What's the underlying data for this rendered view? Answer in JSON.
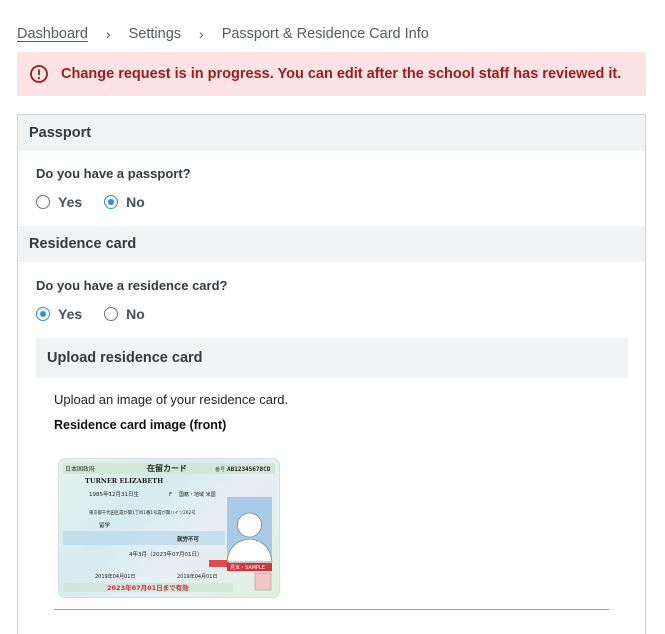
{
  "breadcrumb": {
    "items": [
      "Dashboard",
      "Settings",
      "Passport & Residence Card Info"
    ],
    "separator": "›"
  },
  "alert": {
    "message": "Change request is in progress. You can edit after the school staff has reviewed it.",
    "icon": "info-circle-icon",
    "color": "#9b1c22",
    "background": "#fde3e4"
  },
  "passport": {
    "section_title": "Passport",
    "question": "Do you have a passport?",
    "options": [
      "Yes",
      "No"
    ],
    "selected": "No"
  },
  "residence": {
    "section_title": "Residence card",
    "question": "Do you have a residence card?",
    "options": [
      "Yes",
      "No"
    ],
    "selected": "Yes"
  },
  "upload": {
    "title": "Upload residence card",
    "hint": "Upload an image of your residence card.",
    "image_label": "Residence card image (front)"
  },
  "card_image": {
    "header_left": "日本国政府",
    "header_title": "在留カード",
    "number_label": "番号",
    "number": "AB12345678CD",
    "name": "TURNER ELIZABETH",
    "birth": "1985年12月31日生",
    "sex": "F",
    "nationality": "国籍・地域 米国",
    "address": "東京都千代田区霞が関1丁目1番1号霞が関ハイツ202号",
    "status": "留学",
    "work": "就労不可",
    "period": "4年3月（2023年07月01日）",
    "permit_date": "2019年04月01日",
    "issue_date": "2019年04月01日",
    "expiry": "2023年07月01日まで有効",
    "sample_mark": "見本・SAMPLE",
    "accent": "#c8323a"
  }
}
